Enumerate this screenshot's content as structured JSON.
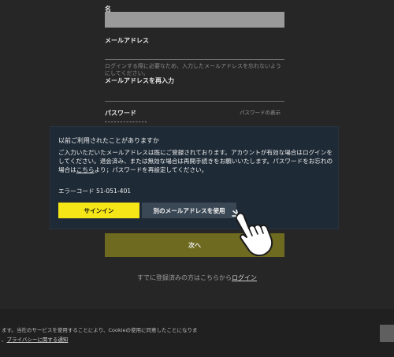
{
  "form": {
    "name_label": "名",
    "email_label": "メールアドレス",
    "email_hint": "ログインする際に必要なため、入力したメールアドレスを忘れないようにしてください。",
    "reenter_label": "メールアドレスを再入力",
    "password_label": "パスワード",
    "password_toggle": "パスワードの表示",
    "password_mask": "--------------",
    "next_button": "次へ",
    "login_prompt": "すでに登録済みの方はこちらから",
    "login_link": "ログイン"
  },
  "modal": {
    "title": "以前ご利用されたことがありますか",
    "body_1": "ご入力いただいたメールアドレスは既にご登録されております。アカウントが有効な場合はログインをしてください。退会済み、または無効な場合は再開手続きをお願いいたします。パスワードをお忘れの場合は",
    "body_link": "こちら",
    "body_2": "より；パスワードを再設定してください。",
    "error_code": "エラーコード 51-051-401",
    "signin_button": "サインイン",
    "other_email_button": "別のメールアドレスを使用"
  },
  "footer": {
    "line_1": "ます。当社のサービスを使用することにより、Cookieの使用に同意したことになりま",
    "line_2_prefix": "、",
    "privacy_link": "プライバシーに関する通知"
  },
  "colors": {
    "background": "#262626",
    "modal_bg": "#1e2a36",
    "accent_yellow": "#f5e617",
    "secondary_button": "#3a4754",
    "next_button": "#6e6a1f"
  },
  "icons": {
    "pointer": "pointing-hand-icon"
  }
}
